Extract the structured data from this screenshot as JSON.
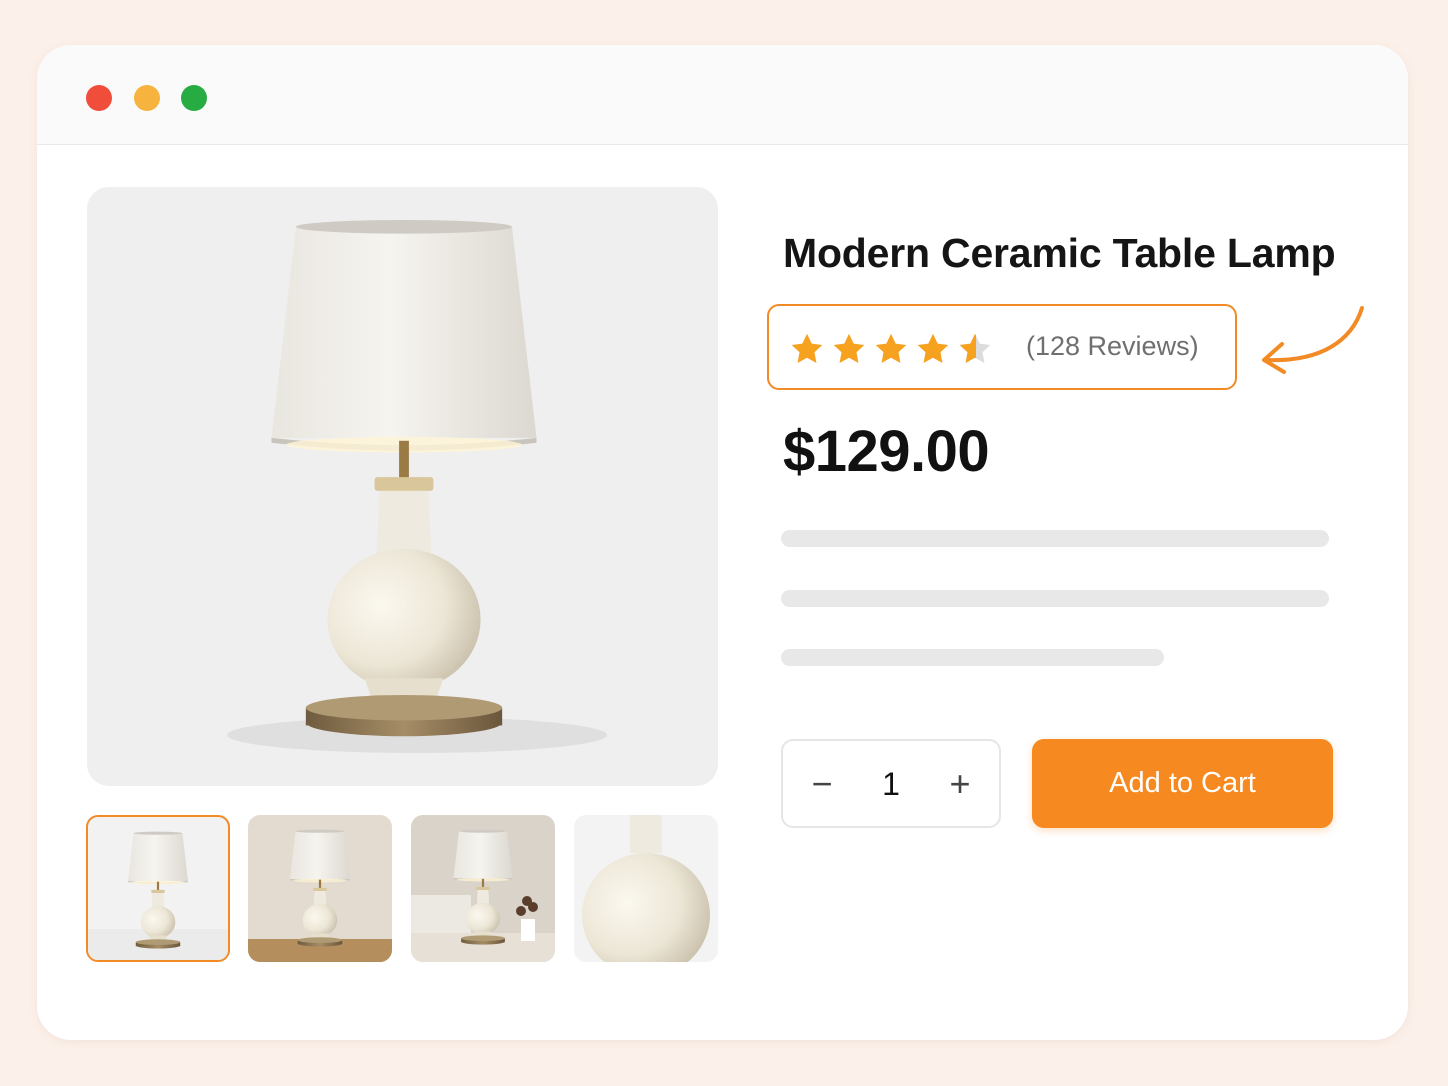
{
  "window": {
    "controls": [
      "close",
      "minimize",
      "maximize"
    ]
  },
  "product": {
    "title": "Modern Ceramic Table Lamp",
    "rating": 4.5,
    "rating_max": 5,
    "reviews_label": "(128 Reviews)",
    "price": "$129.00"
  },
  "gallery": {
    "main_image": "ceramic-table-lamp",
    "thumbnails": [
      "lamp-front",
      "lamp-on-wood-table",
      "lamp-in-bedroom",
      "lamp-base-closeup"
    ],
    "selected_thumbnail": 0
  },
  "purchase": {
    "quantity": "1",
    "minus_label": "−",
    "plus_label": "+",
    "add_to_cart_label": "Add to Cart"
  },
  "colors": {
    "accent": "#f6891f",
    "star": "#f6a21f",
    "background": "#fcf1ea"
  }
}
